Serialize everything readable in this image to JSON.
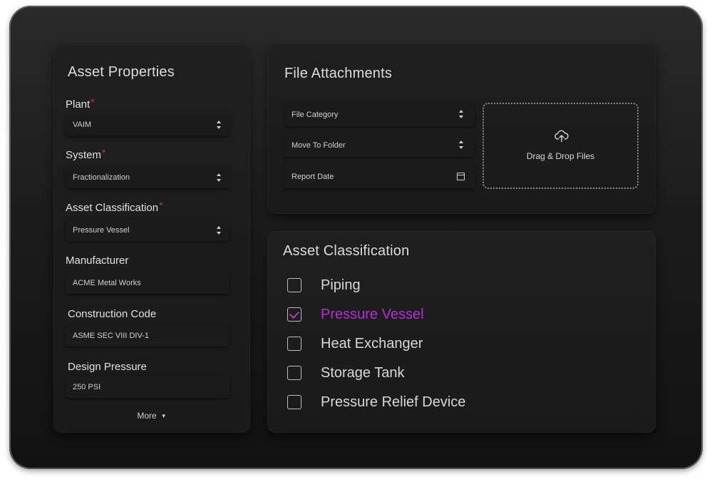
{
  "asset_properties": {
    "title": "Asset Properties",
    "fields": [
      {
        "label": "Plant",
        "required": true,
        "value": "VAIM",
        "type": "select"
      },
      {
        "label": "System",
        "required": true,
        "value": "Fractionalization",
        "type": "select"
      },
      {
        "label": "Asset Classification",
        "required": true,
        "value": "Pressure Vessel",
        "type": "select"
      },
      {
        "label": "Manufacturer",
        "required": false,
        "value": "ACME Metal Works",
        "type": "text"
      },
      {
        "label": "Construction Code",
        "required": false,
        "value": "ASME SEC VIII DIV-1",
        "type": "text"
      },
      {
        "label": "Design Pressure",
        "required": false,
        "value": "250 PSI",
        "type": "text"
      }
    ],
    "required_marker": "*",
    "more_label": "More"
  },
  "file_attachments": {
    "title": "File Attachments",
    "file_category_placeholder": "File Category",
    "move_to_folder_placeholder": "Move To Folder",
    "report_date_placeholder": "Report Date",
    "drop_label": "Drag & Drop Files"
  },
  "asset_classification": {
    "title": "Asset Classification",
    "options": [
      {
        "label": "Piping",
        "checked": false
      },
      {
        "label": "Pressure Vessel",
        "checked": true
      },
      {
        "label": "Heat Exchanger",
        "checked": false
      },
      {
        "label": "Storage Tank",
        "checked": false
      },
      {
        "label": "Pressure Relief Device",
        "checked": false
      }
    ]
  },
  "colors": {
    "accent": "#b62ed8",
    "required": "#d9322f",
    "panel": "#1c1c1c"
  },
  "icons": {
    "select": "chevron-up-down-icon",
    "date": "calendar-icon",
    "upload": "cloud-upload-icon",
    "more": "caret-down-icon",
    "check": "check-icon"
  }
}
